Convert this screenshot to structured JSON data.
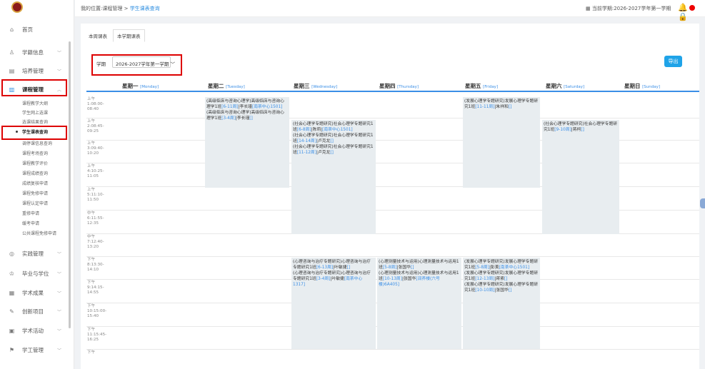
{
  "topbar": {
    "breadcrumb_prefix": "我的位置:课程管理 > ",
    "breadcrumb_current": "学生课表查询",
    "term_label": "当前学期:2026-2027学年第一学期"
  },
  "sidebar": {
    "items": [
      {
        "label": "首页",
        "icon": "home-icon"
      },
      {
        "label": "学籍信息",
        "icon": "user-icon"
      },
      {
        "label": "培养管理",
        "icon": "chart-icon"
      },
      {
        "label": "课程管理",
        "icon": "book-icon"
      },
      {
        "label": "实践管理",
        "icon": "target-icon"
      },
      {
        "label": "毕业与学位",
        "icon": "graduation-icon"
      },
      {
        "label": "学术成果",
        "icon": "bars-icon"
      },
      {
        "label": "创新项目",
        "icon": "edit-icon"
      },
      {
        "label": "学术活动",
        "icon": "grid-icon"
      },
      {
        "label": "学工管理",
        "icon": "flag-icon"
      }
    ],
    "sub_items": [
      "课程教学大纲",
      "学生网上选课",
      "选课结果查询",
      "学生课表查询",
      "调停课信息查询",
      "课程考场查询",
      "课程教学评价",
      "课程成绩查询",
      "成绩复核申请",
      "课程免修申请",
      "课程认定申请",
      "重修申请",
      "缓考申请",
      "公共课程免修申请"
    ]
  },
  "tabs": [
    "本周课表",
    "本学期课表"
  ],
  "filter": {
    "label": "学期",
    "value": "2026-2027学年第一学期"
  },
  "export_label": "导出",
  "days": [
    {
      "cn": "星期一",
      "en": "[Monday]"
    },
    {
      "cn": "星期二",
      "en": "[Tuesday]"
    },
    {
      "cn": "星期三",
      "en": "[Wednesday]"
    },
    {
      "cn": "星期四",
      "en": "[Thursday]"
    },
    {
      "cn": "星期五",
      "en": "[Friday]"
    },
    {
      "cn": "星期六",
      "en": "[Saturday]"
    },
    {
      "cn": "星期日",
      "en": "[Sunday]"
    }
  ],
  "slots": [
    {
      "period": "上午",
      "time": "1:08:00-08:40"
    },
    {
      "period": "上午",
      "time": "2:08:45-09:25"
    },
    {
      "period": "上午",
      "time": "3:09:40-10:20"
    },
    {
      "period": "上午",
      "time": "4:10:25-11:05"
    },
    {
      "period": "上午",
      "time": "5:11:10-11:50"
    },
    {
      "period": "中午",
      "time": "6:11:55-12:35"
    },
    {
      "period": "中午",
      "time": "7:12:40-13:20"
    },
    {
      "period": "下午",
      "time": "8:13:30-14:10"
    },
    {
      "period": "下午",
      "time": "9:14:15-14:55"
    },
    {
      "period": "下午",
      "time": "10:15:00-15:40"
    },
    {
      "period": "下午",
      "time": "11:15:45-16:25"
    },
    {
      "period": "下午",
      "time": ""
    }
  ],
  "courses": {
    "tue_am": [
      "(高级临床与咨询心理学)高级临床与咨询心理学1班",
      "[6-11周]",
      "李长瑾",
      "[南茶中心1501]",
      "(高级临床与咨询心理学)高级临床与咨询心理学1班",
      "[3-4周]",
      "李长瑾",
      "[]"
    ],
    "wed_am": [
      "(社会心理学专题研究)社会心理学专题研究1班",
      "[6-8周]",
      "陈莉",
      "[南茶中心1501]",
      "(社会心理学专题研究)社会心理学专题研究1班",
      "[14-14周]",
      "卢克龙",
      "[]",
      "(社会心理学专题研究)社会心理学专题研究1班",
      "[11-12周]",
      "卢克龙",
      "[]"
    ],
    "fri_am": [
      "(发展心理学专题研究)发展心理学专题研究1班",
      "[11-11周]",
      "朱祥和",
      "[]"
    ],
    "sat_am": [
      "(社会心理学专题研究)社会心理学专题研究1班",
      "[9-10周]",
      "蒋柯",
      "[]"
    ],
    "wed_pm": [
      "(心理咨询与治疗专题研究)心理咨询与治疗专题研究1班",
      "[6-13周]",
      "叶敏捷",
      "[]",
      "(心理咨询与治疗专题研究)心理咨询与治疗专题研究1班",
      "[3-4周]",
      "叶敏捷",
      "[南茶中心1317]"
    ],
    "thu_pm": [
      "(心理测量技术与运用)心理测量技术与运用1班",
      "[5-8周]",
      "张国华",
      "[]",
      "(心理测量技术与运用)心理测量技术与运用1班",
      "[10-13周]",
      "张国华",
      "[润养楼(六号楼)6A405]"
    ],
    "fri_pm": [
      "(发展心理学专题研究)发展心理学专题研究1班",
      "[5-8周]",
      "彭美",
      "[南茶中心1501]",
      "(发展心理学专题研究)发展心理学专题研究1班",
      "[12-13周]",
      "蒋索",
      "[]",
      "(发展心理学专题研究)发展心理学专题研究1班",
      "[10-10周]",
      "张国华",
      "[]"
    ]
  }
}
